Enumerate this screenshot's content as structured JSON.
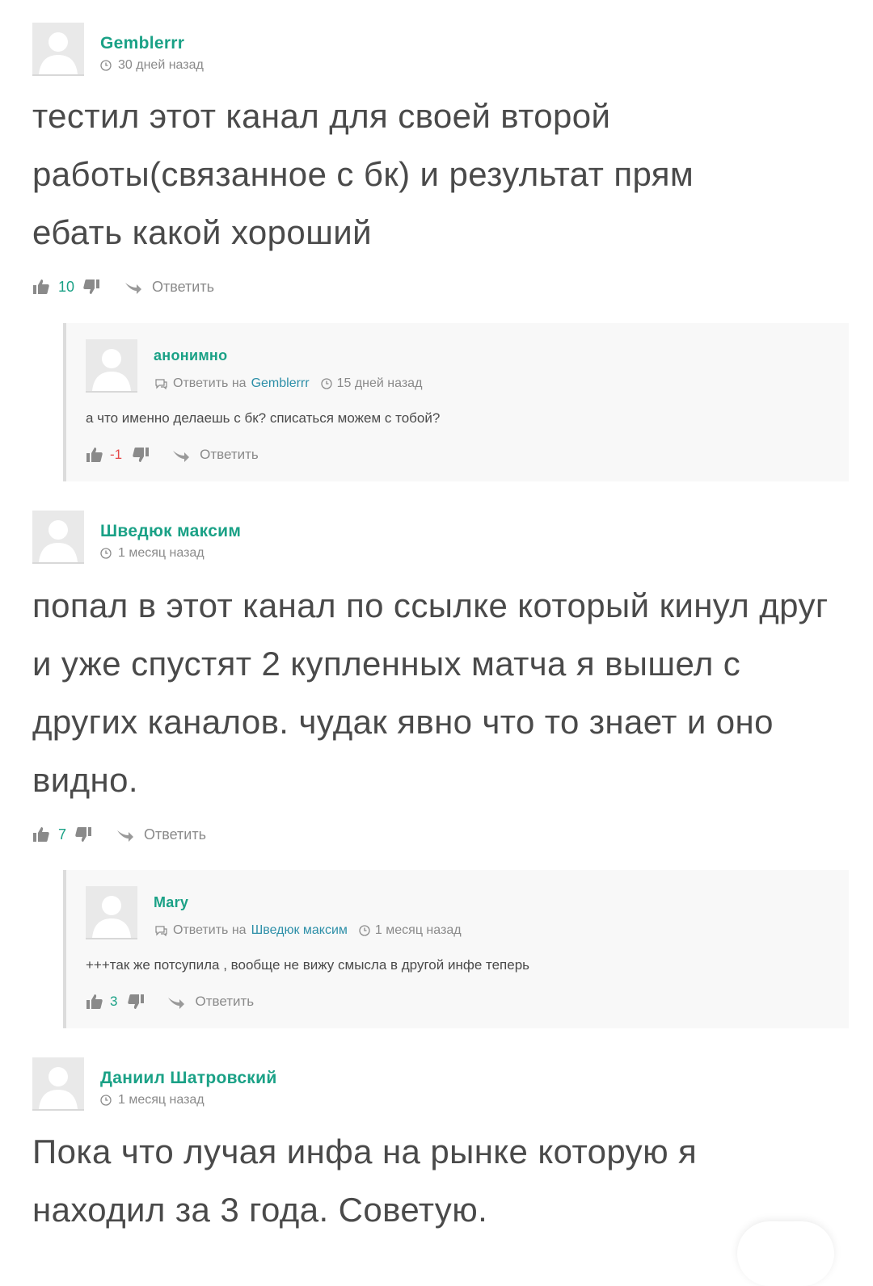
{
  "colors": {
    "accent": "#1aa186",
    "link": "#2d8fa8",
    "negative": "#e5494a",
    "muted": "#8a8a8a",
    "text": "#4a4a4a"
  },
  "comments": [
    {
      "author": "Gemblerrr",
      "time": "30 дней назад",
      "text": "тестил этот канал для своей второй работы(связанное с бк) и результат прям ебать какой хороший",
      "votes": "10",
      "reply_label": "Ответить",
      "replies": [
        {
          "author": "анонимно",
          "reply_to_label": "Ответить на",
          "reply_to": "Gemblerrr",
          "time": "15 дней назад",
          "text": "а что именно делаешь с бк? списаться можем с тобой?",
          "votes": "-1",
          "reply_label": "Ответить"
        }
      ]
    },
    {
      "author": "Шведюк максим",
      "time": "1 месяц назад",
      "text": "попал в этот канал по ссылке который кинул друг и уже спустят 2 купленных матча я вышел с других каналов. чудак явно что то знает и оно видно.",
      "votes": "7",
      "reply_label": "Ответить",
      "replies": [
        {
          "author": "Mary",
          "reply_to_label": "Ответить на",
          "reply_to": "Шведюк максим",
          "time": "1 месяц назад",
          "text": "+++так же потсупила , вообще не вижу смысла в другой инфе теперь",
          "votes": "3",
          "reply_label": "Ответить"
        }
      ]
    },
    {
      "author": "Даниил Шатровский",
      "time": "1 месяц назад",
      "text": "Пока что лучая инфа на рынке которую я находил за 3 года. Советую."
    }
  ]
}
